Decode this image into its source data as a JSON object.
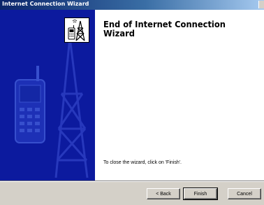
{
  "window": {
    "title": "Internet Connection Wizard"
  },
  "sidebar": {
    "icon": "radio-tower-phone-icon",
    "illustration": "phone-and-tower-illustration"
  },
  "main": {
    "heading_line1": "End of Internet Connection",
    "heading_line2": "Wizard",
    "instruction": "To close the wizard, click on 'Finish'."
  },
  "footer": {
    "back_label": "< Back",
    "finish_label": "Finish",
    "cancel_label": "Cancel"
  },
  "colors": {
    "sidebar_bg": "#0c1a9e",
    "titlebar_start": "#0a246a",
    "titlebar_end": "#a6caf0",
    "footer_bg": "#d4d0c8"
  }
}
